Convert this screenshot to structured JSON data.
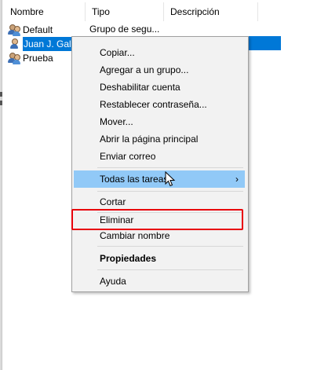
{
  "columns": {
    "name": "Nombre",
    "type": "Tipo",
    "description": "Descripción"
  },
  "rows": [
    {
      "name": "Default",
      "type": "Grupo de segu...",
      "icon": "group-icon"
    },
    {
      "name": "Juan J. Galla",
      "type": "",
      "icon": "user-icon"
    },
    {
      "name": "Prueba",
      "type": "",
      "icon": "group-icon"
    }
  ],
  "menu": {
    "items": [
      {
        "label": "Copiar..."
      },
      {
        "label": "Agregar a un grupo..."
      },
      {
        "label": "Deshabilitar cuenta"
      },
      {
        "label": "Restablecer contraseña..."
      },
      {
        "label": "Mover..."
      },
      {
        "label": "Abrir la página principal"
      },
      {
        "label": "Enviar correo"
      },
      {
        "label": "Todas las tareas",
        "submenu_arrow": "›"
      },
      {
        "label": "Cortar"
      },
      {
        "label": "Eliminar"
      },
      {
        "label": "Cambiar nombre"
      },
      {
        "label": "Propiedades"
      },
      {
        "label": "Ayuda"
      }
    ]
  },
  "colors": {
    "selection": "#0078d7",
    "menu_highlight": "#91c9f7",
    "annotation_box": "#e8000b",
    "menu_background": "#f2f2f2"
  }
}
